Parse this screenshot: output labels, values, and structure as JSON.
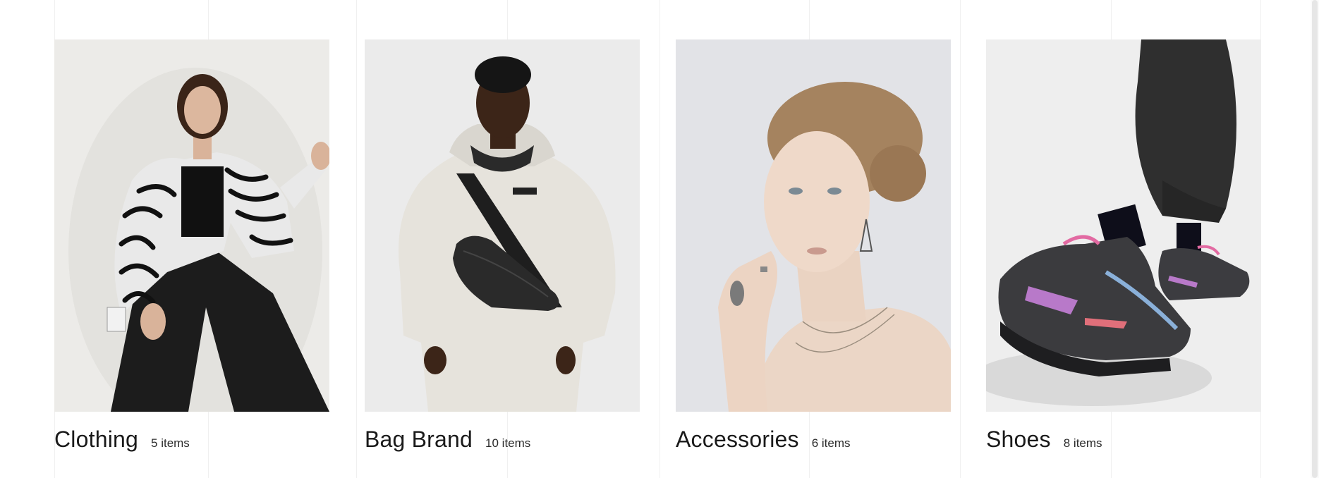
{
  "categories": [
    {
      "name": "Clothing",
      "count": "5 items",
      "image": "model-zebra-fleece-jacket-photo"
    },
    {
      "name": "Bag Brand",
      "count": "10 items",
      "image": "model-crossbody-bag-photo"
    },
    {
      "name": "Accessories",
      "count": "6 items",
      "image": "model-rings-necklace-photo"
    },
    {
      "name": "Shoes",
      "count": "8 items",
      "image": "chunky-sneakers-photo"
    }
  ],
  "colors": {
    "background": "#ffffff",
    "text": "#1a1a1a",
    "grid_line": "#f0f0f0"
  }
}
